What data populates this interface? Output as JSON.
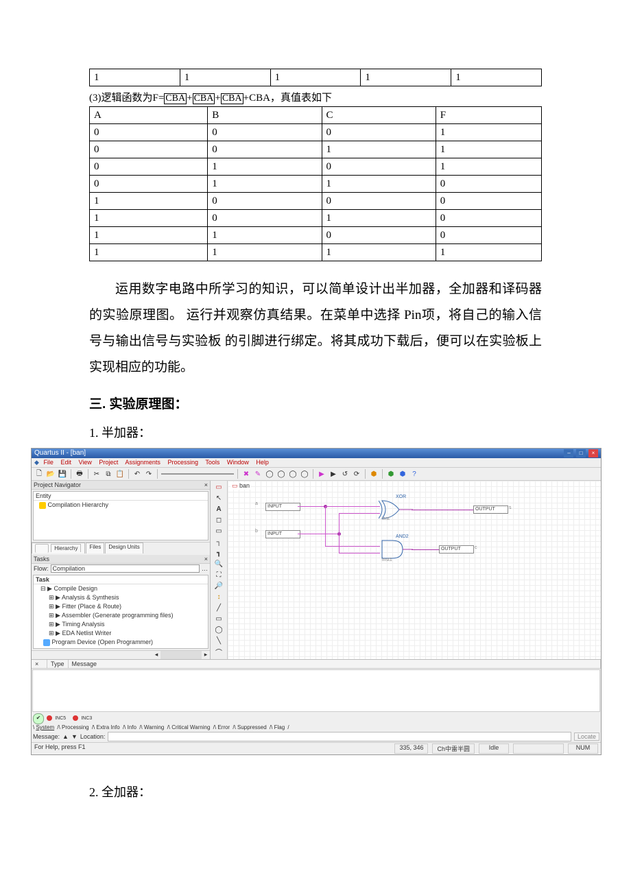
{
  "table_top": {
    "r": [
      "1",
      "1",
      "1",
      "1",
      "1"
    ]
  },
  "formula": {
    "prefix": "(3)逻辑函数为F=",
    "t1": "CBA",
    "t2": "CBA",
    "t3": "CBA",
    "plus": "+",
    "t4": "CBA，",
    "suffix": "真值表如下"
  },
  "truth": {
    "head": [
      "A",
      "B",
      "C",
      "F"
    ],
    "rows": [
      [
        "0",
        "0",
        "0",
        "1"
      ],
      [
        "0",
        "0",
        "1",
        "1"
      ],
      [
        "0",
        "1",
        "0",
        "1"
      ],
      [
        "0",
        "1",
        "1",
        "0"
      ],
      [
        "1",
        "0",
        "0",
        "0"
      ],
      [
        "1",
        "0",
        "1",
        "0"
      ],
      [
        "1",
        "1",
        "0",
        "0"
      ],
      [
        "1",
        "1",
        "1",
        "1"
      ]
    ]
  },
  "para": "运用数字电路中所学习的知识，可以简单设计出半加器，全加器和译码器的实验原理图。 运行并观察仿真结果。在菜单中选择 Pin项，将自己的输入信号与输出信号与实验板 的引脚进行绑定。将其成功下载后，便可以在实验板上实现相应的功能。",
  "section": "三.   实验原理图：",
  "sub1": "1. 半加器：",
  "sub2": "2. 全加器：",
  "app": {
    "title": "Quartus II - [ban]",
    "menus": [
      "File",
      "Edit",
      "View",
      "Project",
      "Assignments",
      "Processing",
      "Tools",
      "Window",
      "Help"
    ],
    "nav_title": "Project Navigator",
    "entity_hdr": "Entity",
    "entity_item": "Compilation Hierarchy",
    "nav_tabs": [
      "Hierarchy",
      "Files",
      "Design Units"
    ],
    "tasks_title": "Tasks",
    "flow_label": "Flow:",
    "flow_value": "Compilation",
    "task_hdr": "Task",
    "tasks": [
      "Compile Design",
      "Analysis & Synthesis",
      "Fitter (Place & Route)",
      "Assembler (Generate programming files)",
      "Timing Analysis",
      "EDA Netlist Writer",
      "Program Device (Open Programmer)"
    ],
    "canvas_title": "ban",
    "pin_a": "a",
    "pin_b": "b",
    "input_lbl": "INPUT",
    "xor_lbl": "XOR",
    "and_lbl": "AND2",
    "inst_xor": "inst",
    "inst_and": "inst1",
    "output_lbl": "OUTPUT",
    "out_s": "s",
    "out_c": "c",
    "msg_cols": [
      "Type",
      "Message"
    ],
    "msg_lines": [
      "INC5",
      "INC3"
    ],
    "msg_tabs": [
      "System",
      "Processing",
      "Extra Info",
      "Info",
      "Warning",
      "Critical Warning",
      "Error",
      "Suppressed",
      "Flag"
    ],
    "loc_label": "Message:",
    "loc_sub": "Location:",
    "loc_btn": "Locate",
    "status_left": "For Help, press F1",
    "status_coord": "335, 346",
    "status_ime": "Ch中雷半圆",
    "status_idle": "Idle",
    "status_num": "NUM"
  }
}
